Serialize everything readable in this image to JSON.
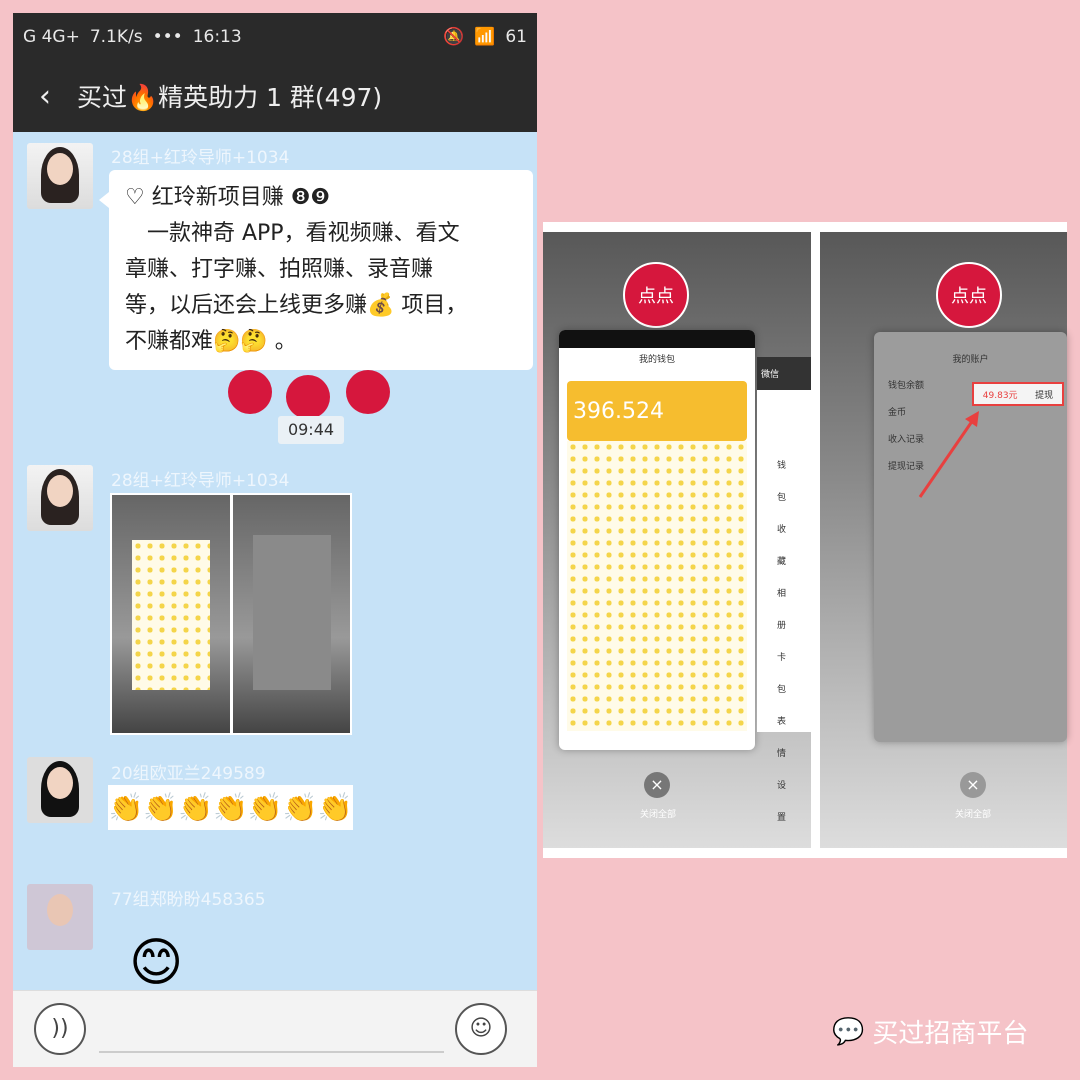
{
  "status_bar": {
    "network": "G 4G+",
    "speed": "7.1K/s",
    "extra": "•••",
    "time": "16:13",
    "battery": "61"
  },
  "header": {
    "back_icon": "chevron-left-icon",
    "title": "买过🔥精英助力 1 群(497)"
  },
  "messages": [
    {
      "sender": "28组+红玲导师+1034",
      "text": [
        "♡ 红玲新项目赚 ❽❾",
        "　一款神奇 APP，看视频赚、看文",
        "章赚、打字赚、拍照赚、录音赚",
        "等，以后还会上线更多赚💰 项目，",
        "不赚都难🤔🤔 。"
      ]
    },
    {
      "time": "09:44"
    },
    {
      "sender": "28组+红玲导师+1034",
      "type": "image"
    },
    {
      "sender": "20组欧亚兰249589",
      "type": "emoji",
      "emoji": "👏👏👏👏👏👏👏"
    },
    {
      "sender": "77组郑盼盼458365",
      "type": "sticker",
      "sticker": "😊"
    }
  ],
  "input_bar": {
    "voice_icon": "voice-icon",
    "emoji_icon": "smile-icon"
  },
  "screenshot": {
    "wallet": {
      "title": "我的钱包",
      "balance": "396.524",
      "menu": [
        "钱包",
        "收藏",
        "相册",
        "卡包",
        "表情",
        "设置"
      ],
      "chat_label": "微信"
    },
    "account": {
      "title": "我的账户",
      "rows": [
        "钱包余额",
        "金币",
        "收入记录",
        "提现记录"
      ],
      "balance": "49.83元",
      "withdraw": "提现",
      "highlight_color": "#e8403f"
    },
    "close_all": "关闭全部",
    "logo_text": "点点"
  },
  "watermark": "买过招商平台"
}
